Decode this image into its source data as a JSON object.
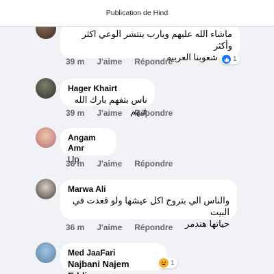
{
  "header": {
    "title": "Publication de Hind"
  },
  "comments": [
    {
      "author": "",
      "text_line1": "ماشاء الله عليهم ويارب ينتشر الوعي اكثر وأكثر",
      "text_line2": "بين شعوبنا العربيه",
      "time": "39 m",
      "like_label": "J'aime",
      "reply_label": "Répondre",
      "reaction_icon": "like-icon",
      "reaction_count": "1"
    },
    {
      "author": "Hager Khairt",
      "text_line1": "ناس بتفهم بارك الله فيهم",
      "time": "39 m",
      "like_label": "J'aime",
      "reply_label": "Répondre"
    },
    {
      "author": "Angam Amr",
      "text_line1": "Up",
      "time": "36 m",
      "like_label": "J'aime",
      "reply_label": "Répondre"
    },
    {
      "author": "Marwa Ali",
      "text_line1": "والناس الي بتروح اكل عيشها ولو قعدت في البيت",
      "text_line2": "حياتها هتدمر",
      "time": "36 m",
      "like_label": "J'aime",
      "reply_label": "Répondre"
    },
    {
      "author": "Med JaaFari",
      "text_line1": "Najbani Najem Eddine",
      "reaction_icon": "haha-icon",
      "reaction_count": "1"
    }
  ],
  "colors": {
    "feed_bg": "#f0f2f5",
    "meta_text": "#65676b",
    "like_blue": "#1877f2"
  }
}
